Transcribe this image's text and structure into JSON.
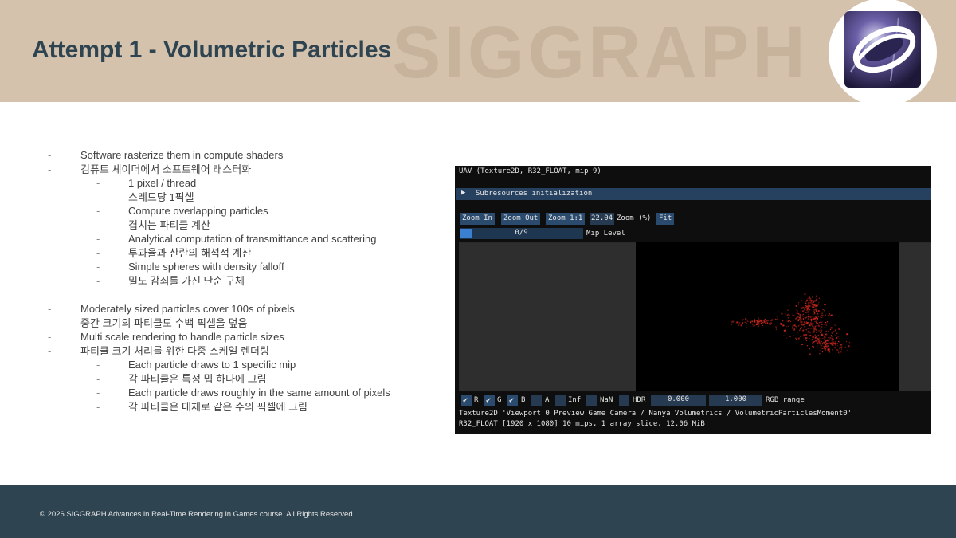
{
  "slide": {
    "title": "Attempt 1 - Volumetric Particles",
    "watermark": "SIGGRAPH",
    "footer": "© 2026 SIGGRAPH Advances in Real-Time Rendering in Games course. All Rights Reserved."
  },
  "bullets": {
    "group1": [
      {
        "level": 1,
        "text": "Software rasterize them in compute shaders"
      },
      {
        "level": 1,
        "text": "컴퓨트 셰이더에서 소프트웨어 래스터화"
      },
      {
        "level": 2,
        "text": "1 pixel / thread"
      },
      {
        "level": 2,
        "text": "스레드당 1픽셀"
      },
      {
        "level": 2,
        "text": "Compute overlapping particles"
      },
      {
        "level": 2,
        "text": "겹치는 파티클 계산"
      },
      {
        "level": 2,
        "text": "Analytical computation of transmittance and scattering"
      },
      {
        "level": 2,
        "text": "투과율과 산란의 해석적 계산"
      },
      {
        "level": 2,
        "text": "Simple spheres with density falloff"
      },
      {
        "level": 2,
        "text": "밀도 감쇠를 가진 단순 구체"
      }
    ],
    "group2": [
      {
        "level": 1,
        "text": "Moderately sized particles cover 100s of pixels"
      },
      {
        "level": 1,
        "text": "중간 크기의 파티클도 수백 픽셀을 덮음"
      },
      {
        "level": 1,
        "text": "Multi scale rendering to handle particle sizes"
      },
      {
        "level": 1,
        "text": "파티클 크기 처리를 위한 다중 스케일 렌더링"
      },
      {
        "level": 2,
        "text": "Each particle draws to 1 specific mip"
      },
      {
        "level": 2,
        "text": "각 파티클은 특정 밉 하나에 그림"
      },
      {
        "level": 2,
        "text": "Each particle draws roughly in the same amount of pixels"
      },
      {
        "level": 2,
        "text": "각 파티클은 대체로 같은 수의 픽셀에 그림"
      }
    ],
    "dash": "-"
  },
  "viewer": {
    "title": "UAV (Texture2D, R32_FLOAT, mip 9)",
    "collapse_arrow": "▶",
    "collapse_label": "Subresources initialization",
    "zoom_in": "Zoom In",
    "zoom_out": "Zoom Out",
    "zoom_1_1": "Zoom 1:1",
    "zoom_value": "22.04",
    "zoom_label": "Zoom (%)",
    "fit": "Fit",
    "mip_value": "0/9",
    "mip_fraction": 0.08,
    "mip_label": "Mip Level",
    "channels": [
      {
        "label": "R",
        "checked": true
      },
      {
        "label": "G",
        "checked": true
      },
      {
        "label": "B",
        "checked": true
      },
      {
        "label": "A",
        "checked": false
      },
      {
        "label": "Inf",
        "checked": false
      },
      {
        "label": "NaN",
        "checked": false
      },
      {
        "label": "HDR",
        "checked": false
      }
    ],
    "check_glyph": "✔",
    "range_min": "0.000",
    "range_max": "1.000",
    "range_label": "RGB range",
    "info_line1": "Texture2D 'Viewport 0 Preview Game Camera / Nanya Volumetrics / VolumetricParticlesMoment0'",
    "info_line2": "R32_FLOAT [1920 x 1080] 10 mips,  1 array slice,  12.06 MiB",
    "particle_color": "#d0271d"
  },
  "colors": {
    "header_bg": "#d4c2ad",
    "footer_bg": "#2f4451",
    "title_color": "#2f4451",
    "viewer_bg": "#0e0e0e",
    "button_bg": "#2a4b6e"
  }
}
